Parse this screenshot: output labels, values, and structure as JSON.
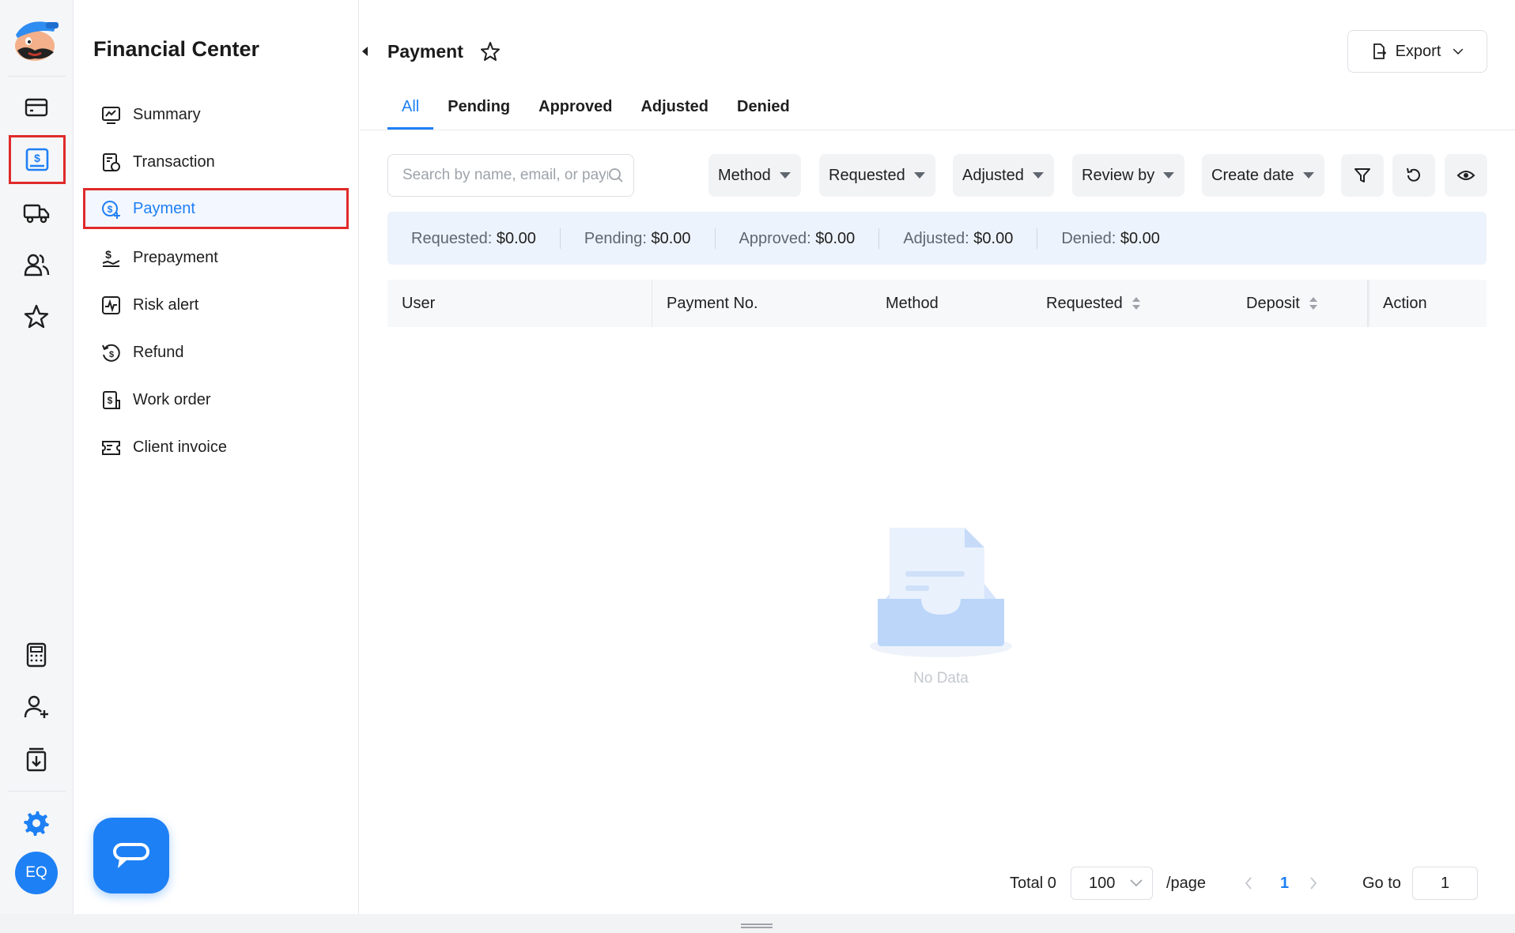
{
  "rail": {
    "icons": [
      "wallet-icon",
      "dollar-invoice-icon",
      "truck-icon",
      "users-icon",
      "star-icon",
      "calculator-icon",
      "add-user-icon",
      "download-box-icon",
      "gear-icon"
    ],
    "avatar_initials": "EQ"
  },
  "menu": {
    "title": "Financial Center",
    "items": [
      {
        "label": "Summary",
        "icon": "chart-icon"
      },
      {
        "label": "Transaction",
        "icon": "transaction-icon"
      },
      {
        "label": "Payment",
        "icon": "payment-icon",
        "active": true
      },
      {
        "label": "Prepayment",
        "icon": "prepayment-icon"
      },
      {
        "label": "Risk alert",
        "icon": "risk-alert-icon"
      },
      {
        "label": "Refund",
        "icon": "refund-icon"
      },
      {
        "label": "Work order",
        "icon": "work-order-icon"
      },
      {
        "label": "Client invoice",
        "icon": "client-invoice-icon"
      }
    ]
  },
  "header": {
    "title": "Payment",
    "export_label": "Export"
  },
  "tabs": [
    "All",
    "Pending",
    "Approved",
    "Adjusted",
    "Denied"
  ],
  "active_tab": "All",
  "search": {
    "placeholder": "Search by name, email, or payment No.",
    "value": ""
  },
  "filters": [
    "Method",
    "Requested",
    "Adjusted",
    "Review by",
    "Create date"
  ],
  "summary": [
    {
      "label": "Requested:",
      "value": "$0.00"
    },
    {
      "label": "Pending:",
      "value": "$0.00"
    },
    {
      "label": "Approved:",
      "value": "$0.00"
    },
    {
      "label": "Adjusted:",
      "value": "$0.00"
    },
    {
      "label": "Denied:",
      "value": "$0.00"
    }
  ],
  "table": {
    "columns": [
      "User",
      "Payment No.",
      "Method",
      "Requested",
      "Deposit",
      "Action"
    ],
    "rows": [],
    "empty_text": "No Data"
  },
  "pagination": {
    "total_label": "Total 0",
    "page_size": "100",
    "per_page_label": "/page",
    "current_page": "1",
    "goto_label": "Go to",
    "goto_value": "1"
  },
  "colors": {
    "accent": "#1e80f5",
    "highlight_box": "#e02a2a",
    "summary_bg": "#edf3fc"
  }
}
